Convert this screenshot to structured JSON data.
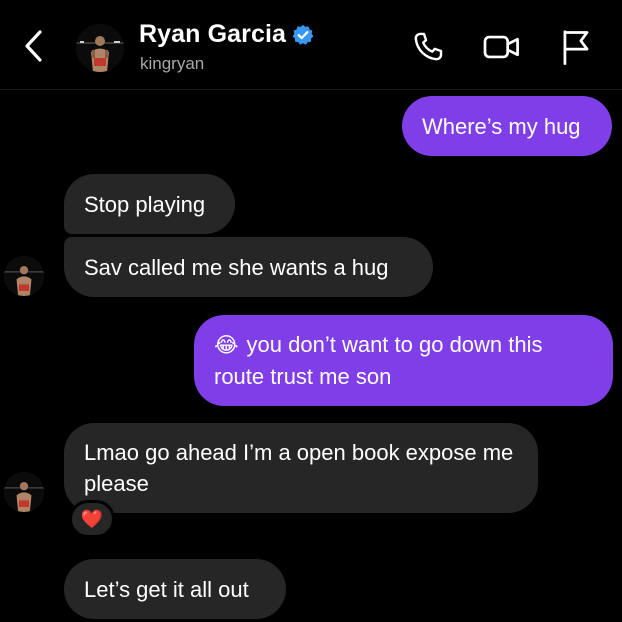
{
  "header": {
    "name": "Ryan Garcia",
    "username": "kingryan",
    "verified": true,
    "icons": [
      "back-chevron-icon",
      "phone-icon",
      "video-camera-icon",
      "flag-icon"
    ]
  },
  "colors": {
    "background": "#000000",
    "incoming_bubble": "#262626",
    "outgoing_bubble": "#7f3ee8",
    "verified_badge": "#3897f0",
    "muted_text": "#a8a8a8"
  },
  "messages": [
    {
      "direction": "outgoing",
      "text": "Where’s my hug"
    },
    {
      "direction": "incoming",
      "text": "Stop playing"
    },
    {
      "direction": "incoming",
      "text": "Sav called me she wants a hug"
    },
    {
      "direction": "outgoing",
      "emoji": "😂",
      "text": "you don’t want to go down this route trust me son"
    },
    {
      "direction": "incoming",
      "text": "Lmao go ahead I’m a open book expose me please",
      "reaction": "❤️"
    },
    {
      "direction": "incoming",
      "text": "Let’s get it all out"
    }
  ]
}
